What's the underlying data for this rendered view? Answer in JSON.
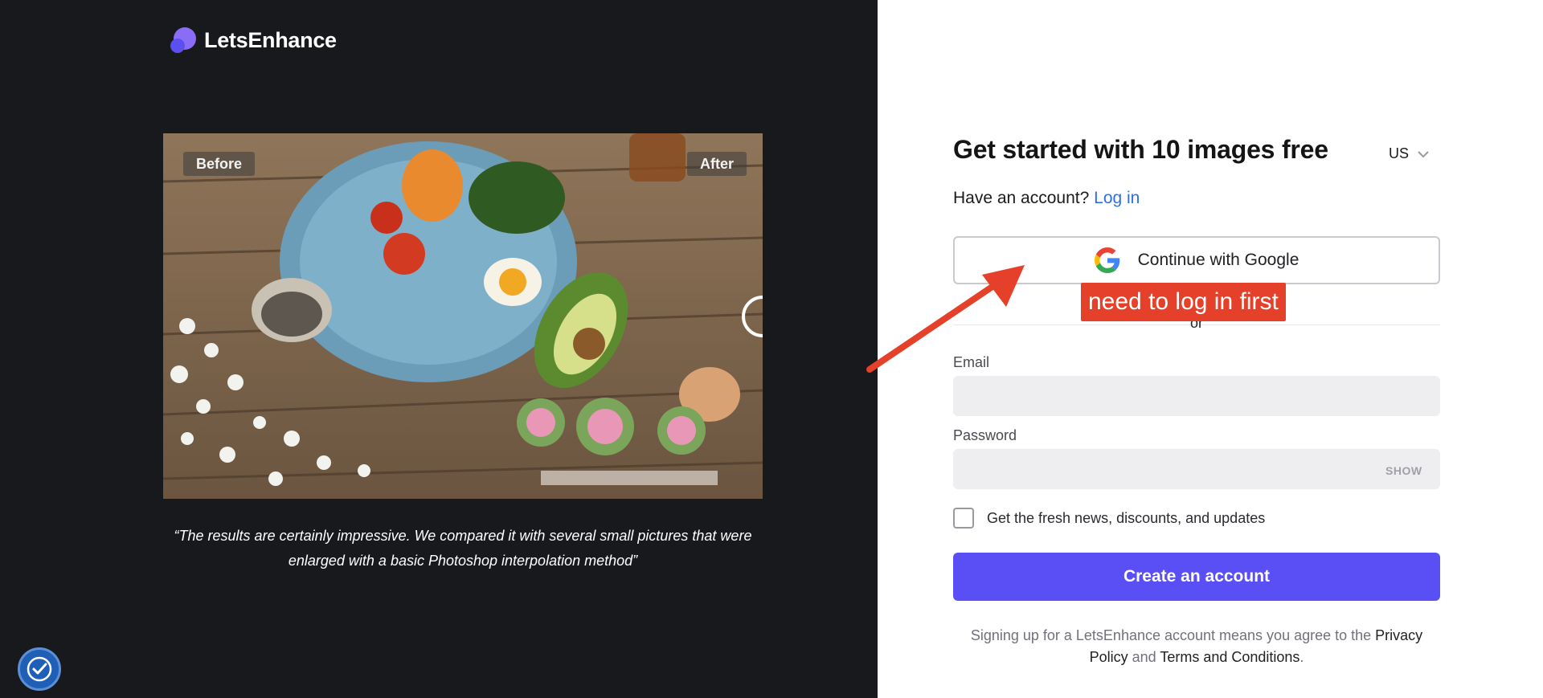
{
  "brand": {
    "name": "LetsEnhance"
  },
  "showcase": {
    "before_label": "Before",
    "after_label": "After",
    "quote": "“The results are certainly impressive. We compared it with several small pictures that were enlarged with a basic Photoshop interpolation method”"
  },
  "signup": {
    "heading": "Get started with 10 images free",
    "language": "US",
    "have_account": "Have an account?",
    "login_link": "Log in",
    "google_button": "Continue with Google",
    "or_text": "or",
    "email_label": "Email",
    "email_value": "",
    "password_label": "Password",
    "password_value": "",
    "show_label": "SHOW",
    "newsletter_label": "Get the fresh news, discounts, and updates",
    "newsletter_checked": false,
    "create_button": "Create an account",
    "terms_prefix": "Signing up for a LetsEnhance account means you agree to the",
    "privacy_link": "Privacy Policy",
    "terms_and": "and",
    "terms_link": "Terms and Conditions",
    "terms_suffix": "."
  },
  "annotation": {
    "note": "need to log in first",
    "color": "#e5402a"
  },
  "colors": {
    "accent": "#5a4ff4",
    "link": "#2f6fe0",
    "dark_panel": "#18191d"
  },
  "icons": [
    "logo-icon",
    "google-icon",
    "chevron-down-icon",
    "accessibility-icon",
    "compare-handle-icon"
  ]
}
